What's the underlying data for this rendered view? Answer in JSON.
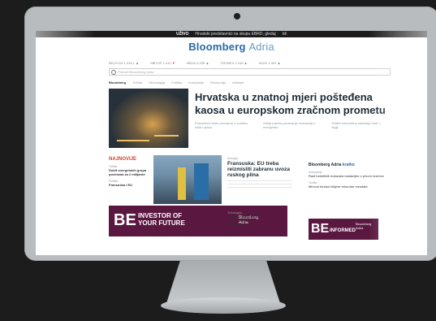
{
  "topbar": {
    "tag": "UŽIVO",
    "text": "Hrvatski predstavnici na skupu EBRD, gledaj",
    "link": "Idi"
  },
  "site": {
    "name": "Bloomberg",
    "region": "Adria"
  },
  "ticker": [
    {
      "name": "BELEX15",
      "value": "1.015,1",
      "change": "▲",
      "dir": "up"
    },
    {
      "name": "SBITOP",
      "value": "1.410",
      "change": "▼",
      "dir": "dn"
    },
    {
      "name": "MBI10",
      "value": "6.236",
      "change": "▲",
      "dir": "up"
    },
    {
      "name": "CROBEX",
      "value": "2.245",
      "change": "▲",
      "dir": "up"
    },
    {
      "name": "SASX",
      "value": "1.302",
      "change": "▲",
      "dir": "up"
    }
  ],
  "search": {
    "placeholder": "Pretraži Bloomberg Adria"
  },
  "nav": [
    "Bloomberg",
    "Tržišta",
    "Tehnologija",
    "Politika",
    "Kompanije",
    "Ekonomija",
    "Lifestyle"
  ],
  "hero": {
    "title": "Hrvatska u znatnoj mjeri pošteđena kaosa u europskom zračnom prometu",
    "subs": [
      "Poslodavci traže promjene u sustavu rada i plaća",
      "Srbija planira povećanje investicija u energetiku",
      "Tržište nekretnina nastavlja rasti u regiji"
    ]
  },
  "left": {
    "kicker": "NAJNOVIJE",
    "items": [
      {
        "label": "Tržišta",
        "text": "Dobit energetskih grupa povećana za 2 milijarde"
      },
      {
        "label": "Politika",
        "text": "Fransuska i EU"
      }
    ]
  },
  "mid": {
    "label": "Energija",
    "title": "Fransuska: EU treba reizmisliti zabranu uvoza ruskog plina"
  },
  "mid2": {
    "label": "Tehnologija",
    "title": "Hrvatske kompanije ulažu u digitalnu transformaciju"
  },
  "ad1": {
    "be": "BE",
    "line1": "INVESTOR OF",
    "line2": "YOUR FUTURE",
    "brand1": "Bloomberg",
    "brand2": "Adria"
  },
  "side": {
    "title": "Bloomberg Adria",
    "title_acc": "kratko",
    "items": [
      {
        "label": "Kompanije",
        "text": "Rast turističkih dolazaka nastavljen u prvom kvartalu"
      },
      {
        "label": "Tržišta",
        "text": "Mirovni fondovi bilježe rekordne rezultate"
      }
    ]
  },
  "ad2": {
    "be": "BE",
    "text": "INFORMED",
    "brand": "Bloomberg Adria"
  }
}
